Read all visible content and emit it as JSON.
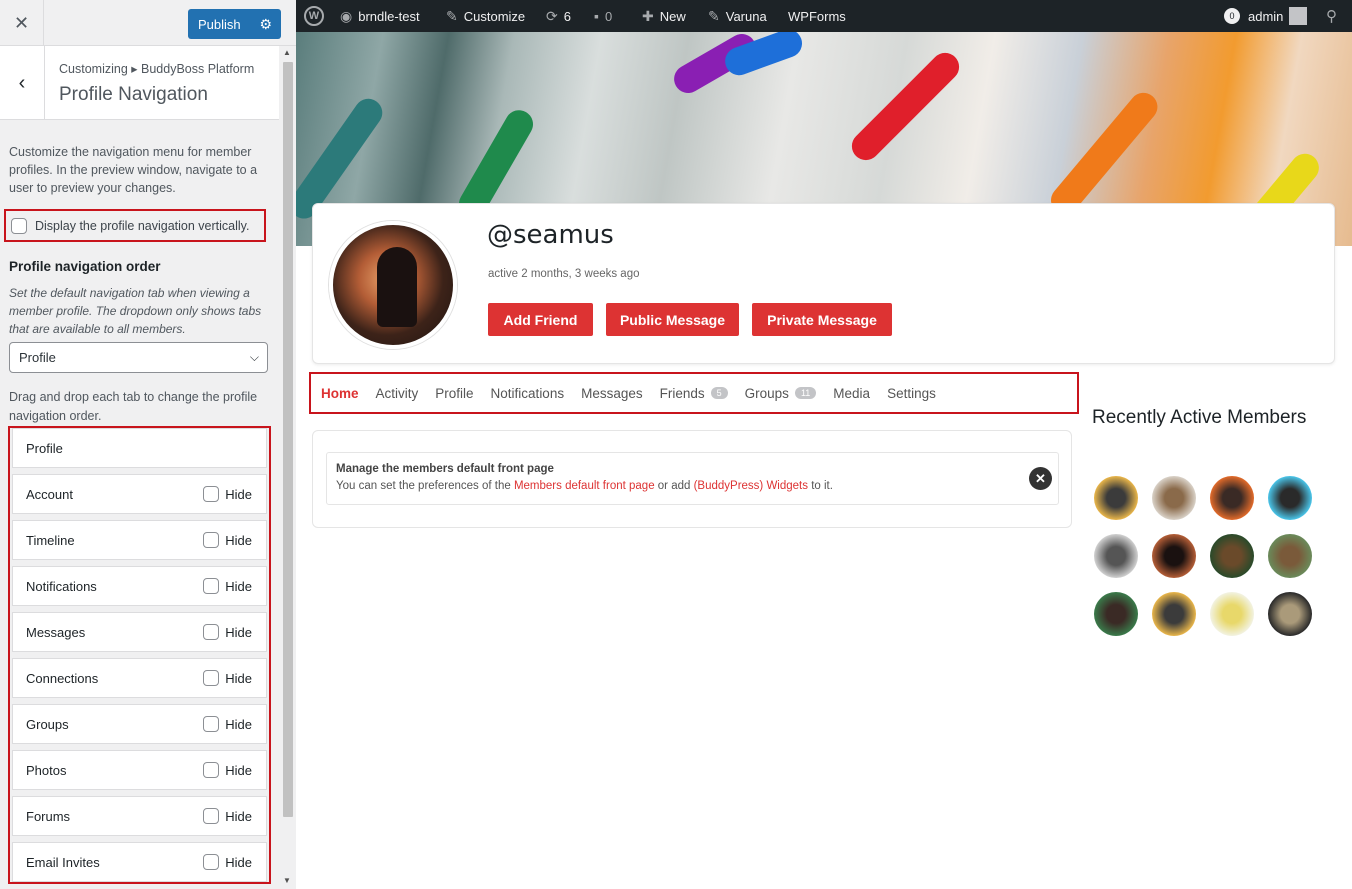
{
  "sidebar": {
    "close_icon": "close-icon",
    "publish_label": "Publish",
    "breadcrumb": "Customizing ▸ BuddyBoss Platform",
    "title": "Profile Navigation",
    "description": "Customize the navigation menu for member profiles. In the preview window, navigate to a user to preview your changes.",
    "vertical_label": "Display the profile navigation vertically.",
    "order_title": "Profile navigation order",
    "order_help": "Set the default navigation tab when viewing a member profile. The dropdown only shows tabs that are available to all members.",
    "select_value": "Profile",
    "drag_help": "Drag and drop each tab to change the profile navigation order.",
    "hide_label": "Hide",
    "tabs": [
      "Profile",
      "Account",
      "Timeline",
      "Notifications",
      "Messages",
      "Connections",
      "Groups",
      "Photos",
      "Forums",
      "Email Invites"
    ]
  },
  "adminbar": {
    "site": "brndle-test",
    "customize": "Customize",
    "updates": "6",
    "comments": "0",
    "new": "New",
    "theme": "Varuna",
    "forms": "WPForms",
    "notif_count": "0",
    "user": "admin"
  },
  "profile": {
    "handle": "@seamus",
    "active": "active 2 months, 3 weeks ago",
    "buttons": [
      "Add Friend",
      "Public Message",
      "Private Message"
    ],
    "nav": [
      {
        "label": "Home",
        "badge": ""
      },
      {
        "label": "Activity",
        "badge": ""
      },
      {
        "label": "Profile",
        "badge": ""
      },
      {
        "label": "Notifications",
        "badge": ""
      },
      {
        "label": "Messages",
        "badge": ""
      },
      {
        "label": "Friends",
        "badge": "5"
      },
      {
        "label": "Groups",
        "badge": "11"
      },
      {
        "label": "Media",
        "badge": ""
      },
      {
        "label": "Settings",
        "badge": ""
      }
    ],
    "notice_title": "Manage the members default front page",
    "notice_pre": "You can set the preferences of the ",
    "notice_link1": "Members default front page",
    "notice_mid": " or add ",
    "notice_link2": "(BuddyPress) Widgets",
    "notice_post": " to it.",
    "recent_title": "Recently Active Members"
  },
  "colors": {
    "accent": "#dd3333",
    "primary": "#2271b1",
    "highlight": "#c8141c"
  }
}
